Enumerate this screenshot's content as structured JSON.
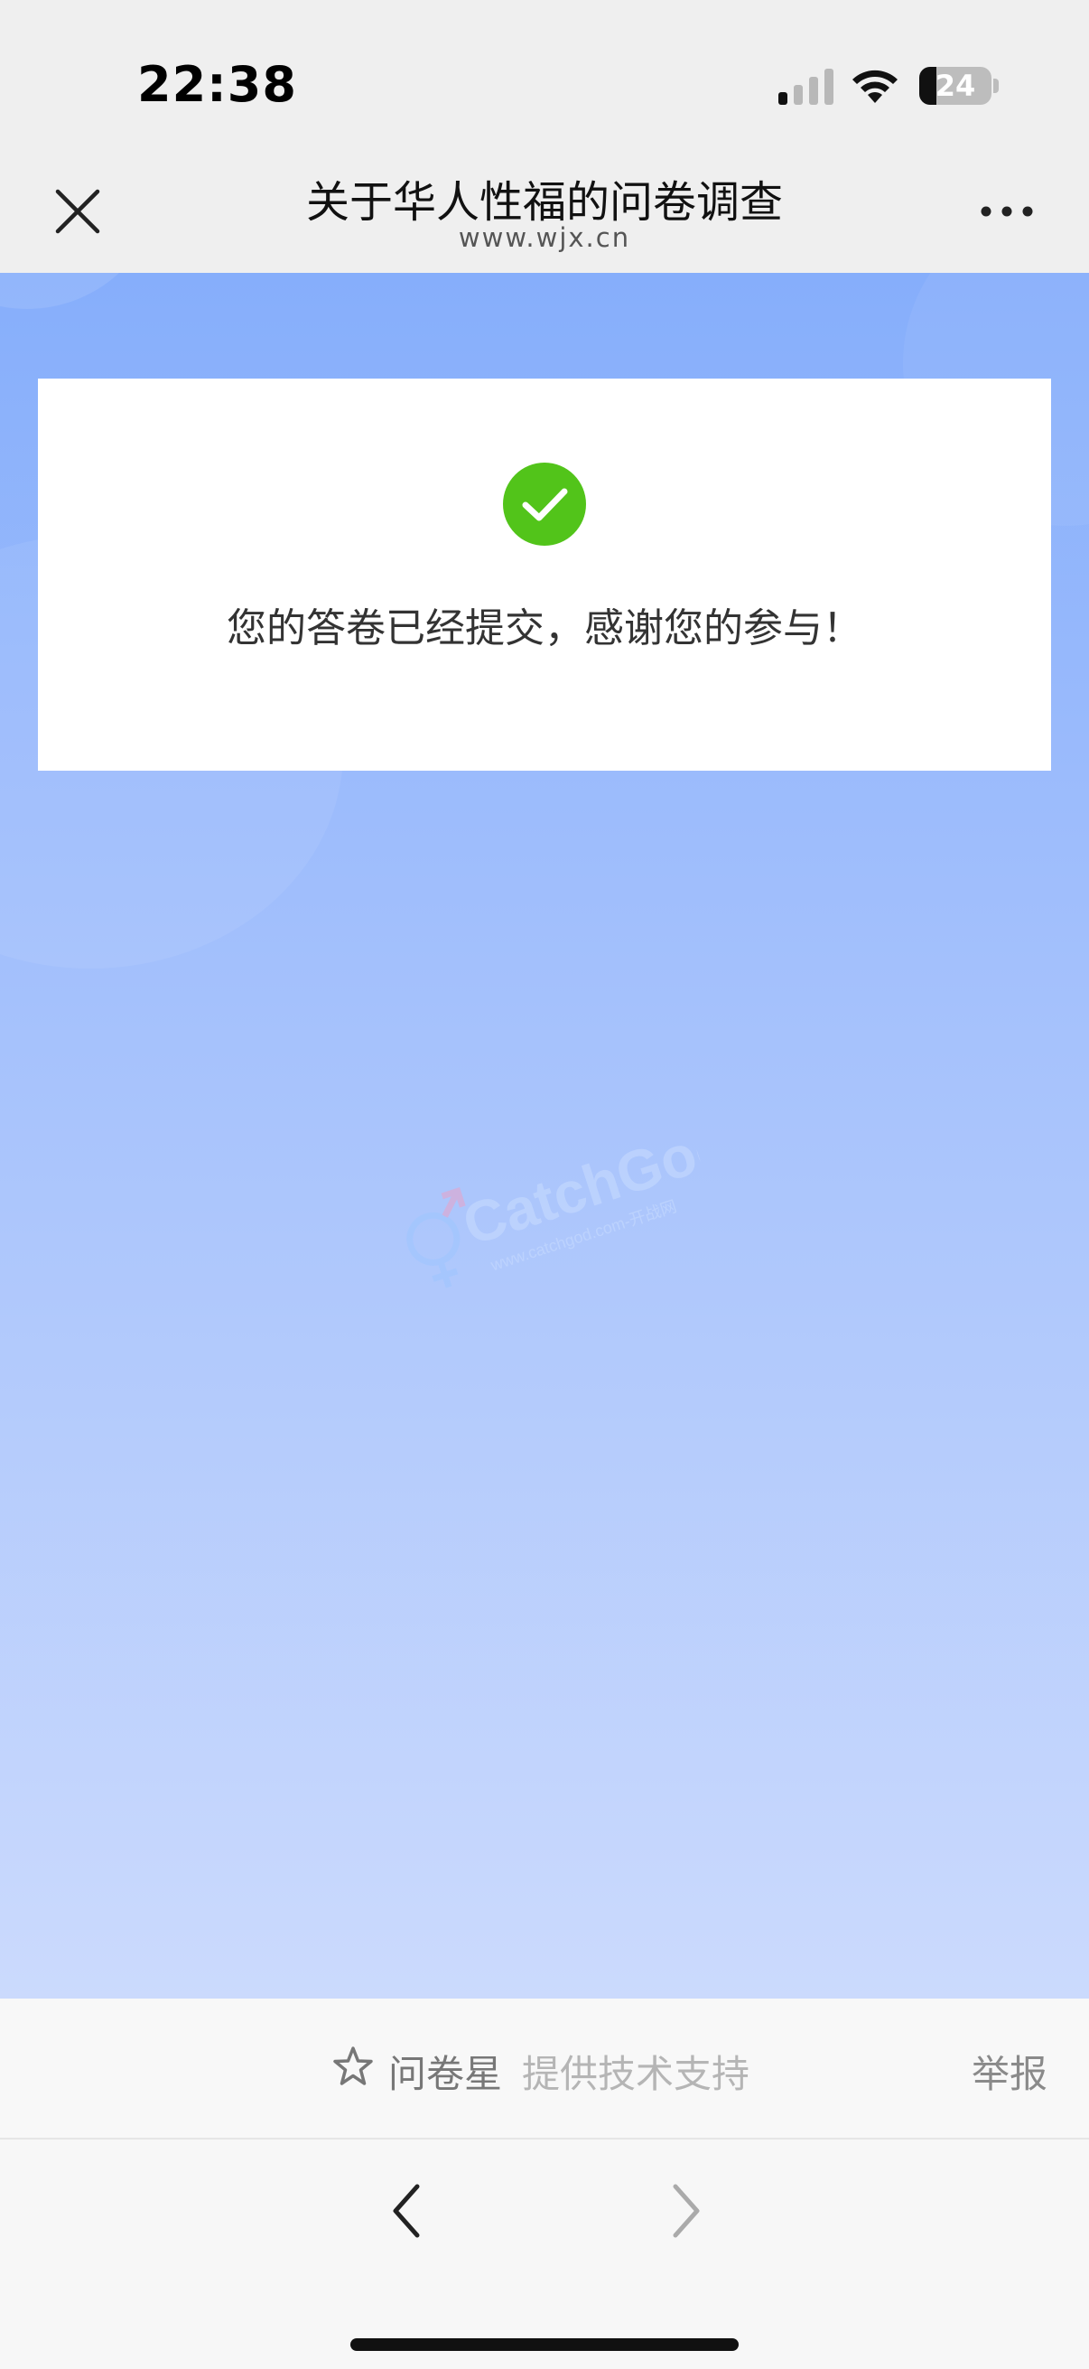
{
  "status_bar": {
    "time": "22:38",
    "battery_level": "24",
    "battery_fraction": 0.24,
    "icons": [
      "cellular-signal-icon",
      "wifi-icon",
      "battery-icon"
    ]
  },
  "nav": {
    "title": "关于华人性福的问卷调查",
    "subtitle": "www.wjx.cn",
    "icons": [
      "close-icon",
      "more-icon"
    ]
  },
  "result": {
    "message": "您的答卷已经提交，感谢您的参与！",
    "icon": "check-circle-icon",
    "icon_color": "#52c41a"
  },
  "watermark": {
    "text": "CatchGod",
    "url_text": "www.catchgod.com-开战网"
  },
  "footer": {
    "brand_name": "问卷星",
    "support_text": "提供技术支持",
    "report_label": "举报",
    "brand_icon": "star-outline-icon"
  },
  "browser_nav": {
    "icons": [
      "chevron-left-icon",
      "chevron-right-icon"
    ]
  },
  "colors": {
    "content_gradient_top": "#86aefb",
    "content_gradient_bottom": "#cbdafd",
    "success_green": "#52c41a"
  }
}
